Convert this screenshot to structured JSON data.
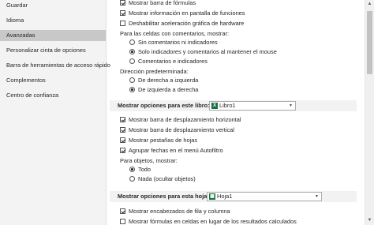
{
  "sidebar": {
    "items": [
      {
        "label": "Guardar",
        "active": false
      },
      {
        "label": "Idioma",
        "active": false
      },
      {
        "label": "Avanzadas",
        "active": true
      },
      {
        "label": "Personalizar cinta de opciones",
        "active": false
      },
      {
        "label": "Barra de herramientas de acceso rápido",
        "active": false
      },
      {
        "label": "Complementos",
        "active": false
      },
      {
        "label": "Centro de confianza",
        "active": false
      }
    ]
  },
  "display": {
    "formula_bar": "Mostrar barra de fórmulas",
    "function_tooltips": "Mostrar información en pantalla de funciones",
    "disable_hw_accel": "Deshabilitar aceleración gráfica de hardware",
    "comments_heading": "Para las celdas con comentarios, mostrar:",
    "comments_none": "Sin comentarios ni indicadores",
    "comments_indicators_only": "Solo indicadores y comentarios al mantener el mouse",
    "comments_and_indicators": "Comentarios e indicadores",
    "direction_heading": "Dirección predeterminada:",
    "direction_rtl": "De derecha a izquierda",
    "direction_ltr": "De izquierda a derecha"
  },
  "workbook": {
    "section_label": "Mostrar opciones para este libro:",
    "combo_value": "Libro1",
    "horizontal_scroll": "Mostrar barra de desplazamiento horizontal",
    "vertical_scroll": "Mostrar barra de desplazamiento vertical",
    "sheet_tabs": "Mostrar pestañas de hojas",
    "group_dates": "Agrupar fechas en el menú Autofiltro",
    "objects_heading": "Para objetos, mostrar:",
    "objects_all": "Todo",
    "objects_none": "Nada (ocultar objetos)"
  },
  "worksheet": {
    "section_label": "Mostrar opciones para esta hoja:",
    "combo_value": "Hoja1",
    "row_col_headers": "Mostrar encabezados de fila y columna",
    "show_formulas": "Mostrar fórmulas en celdas en lugar de los resultados calculados"
  }
}
